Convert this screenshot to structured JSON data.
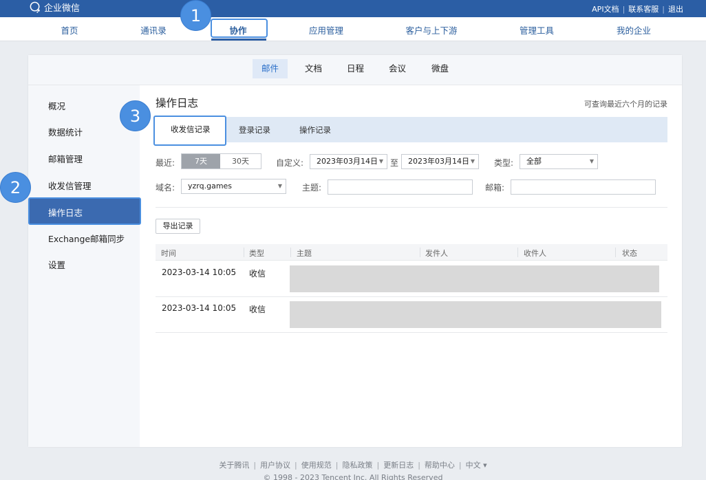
{
  "topbar": {
    "logo_text": "企业微信",
    "links": [
      "API文档",
      "联系客服",
      "退出"
    ]
  },
  "nav": {
    "items": [
      "首页",
      "通讯录",
      "协作",
      "应用管理",
      "客户与上下游",
      "管理工具",
      "我的企业"
    ],
    "active": "协作"
  },
  "callouts": [
    "1",
    "2",
    "3"
  ],
  "subnav": {
    "items": [
      "邮件",
      "文档",
      "日程",
      "会议",
      "微盘"
    ],
    "active": "邮件"
  },
  "sidebar": {
    "items": [
      "概况",
      "数据统计",
      "邮箱管理",
      "收发信管理",
      "操作日志",
      "Exchange邮箱同步",
      "设置"
    ],
    "active": "操作日志"
  },
  "page": {
    "title": "操作日志",
    "note": "可查询最近六个月的记录"
  },
  "tabs": {
    "items": [
      "收发信记录",
      "登录记录",
      "操作记录"
    ],
    "active": "收发信记录"
  },
  "filters": {
    "recent_label": "最近:",
    "recent_options": [
      "7天",
      "30天"
    ],
    "custom_label": "自定义:",
    "date_from": "2023年03月14日",
    "to_label": "至",
    "date_to": "2023年03月14日",
    "type_label": "类型:",
    "type_value": "全部",
    "domain_label": "域名:",
    "domain_value": "yzrq.games",
    "subject_label": "主题:",
    "mailbox_label": "邮箱:"
  },
  "export_button": "导出记录",
  "table": {
    "columns": [
      "时间",
      "类型",
      "主题",
      "发件人",
      "收件人",
      "状态"
    ],
    "rows": [
      {
        "time": "2023-03-14 10:05",
        "type": "收信"
      },
      {
        "time": "2023-03-14 10:05",
        "type": "收信"
      }
    ]
  },
  "footer": {
    "links": [
      "关于腾讯",
      "用户协议",
      "使用规范",
      "隐私政策",
      "更新日志",
      "帮助中心",
      "中文 ▾"
    ],
    "copyright": "© 1998 - 2023 Tencent Inc. All Rights Reserved"
  },
  "colors": {
    "brand": "#2b5ea5",
    "callout": "#4a8fe0",
    "sidebar_active": "#3b6ab0"
  }
}
